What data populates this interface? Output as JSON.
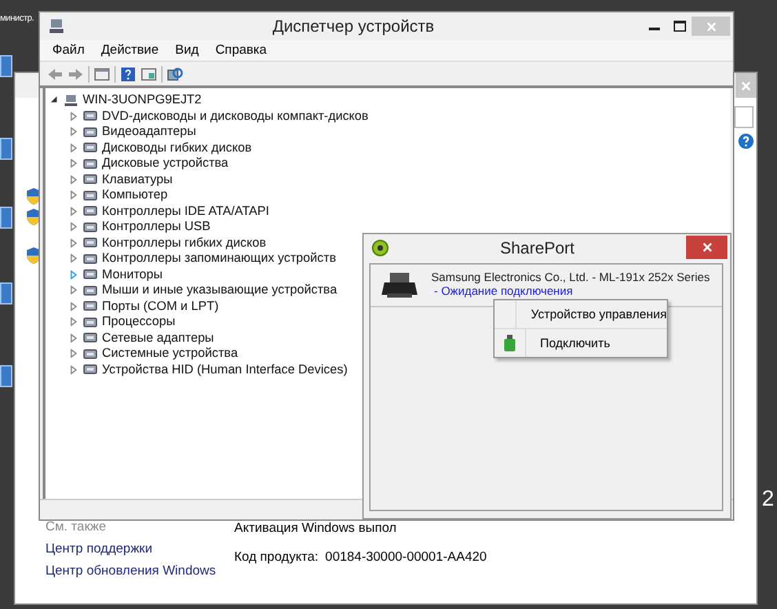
{
  "desktop": {
    "icon_labels": [
      "министр."
    ],
    "corner_text": "2"
  },
  "system_window": {
    "see_also_heading": "См. также",
    "links": [
      "Центр поддержки",
      "Центр обновления Windows"
    ],
    "activation_text": "Активация Windows выпол",
    "product_code_label": "Код продукта:",
    "product_code": "00184-30000-00001-AA420"
  },
  "device_manager": {
    "title": "Диспетчер устройств",
    "menu": [
      "Файл",
      "Действие",
      "Вид",
      "Справка"
    ],
    "tree": {
      "label": "WIN-3UONPG9EJT2",
      "expanded": true,
      "children": [
        {
          "label": "DVD-дисководы и дисководы компакт-дисков",
          "expanded": false,
          "hovered": false
        },
        {
          "label": "Видеоадаптеры",
          "expanded": false,
          "hovered": false
        },
        {
          "label": "Дисководы гибких дисков",
          "expanded": false,
          "hovered": false
        },
        {
          "label": "Дисковые устройства",
          "expanded": false,
          "hovered": false
        },
        {
          "label": "Клавиатуры",
          "expanded": false,
          "hovered": false
        },
        {
          "label": "Компьютер",
          "expanded": false,
          "hovered": false
        },
        {
          "label": "Контроллеры IDE ATA/ATAPI",
          "expanded": false,
          "hovered": false
        },
        {
          "label": "Контроллеры USB",
          "expanded": false,
          "hovered": false
        },
        {
          "label": "Контроллеры гибких дисков",
          "expanded": false,
          "hovered": false
        },
        {
          "label": "Контроллеры запоминающих устройств",
          "expanded": false,
          "hovered": false
        },
        {
          "label": "Мониторы",
          "expanded": false,
          "hovered": true
        },
        {
          "label": "Мыши и иные указывающие устройства",
          "expanded": false,
          "hovered": false
        },
        {
          "label": "Порты (COM и LPT)",
          "expanded": false,
          "hovered": false
        },
        {
          "label": "Процессоры",
          "expanded": false,
          "hovered": false
        },
        {
          "label": "Сетевые адаптеры",
          "expanded": false,
          "hovered": false
        },
        {
          "label": "Системные устройства",
          "expanded": false,
          "hovered": false
        },
        {
          "label": "Устройства HID (Human Interface Devices)",
          "expanded": false,
          "hovered": false
        }
      ]
    }
  },
  "shareport": {
    "title": "SharePort",
    "device": {
      "name": "Samsung Electronics Co., Ltd. - ML-191x 252x Series",
      "status": "- Ожидание подключения"
    },
    "context_menu": [
      {
        "label": "Устройство управления",
        "kind": "plain"
      },
      {
        "label": "Подключить",
        "kind": "usb"
      }
    ]
  }
}
